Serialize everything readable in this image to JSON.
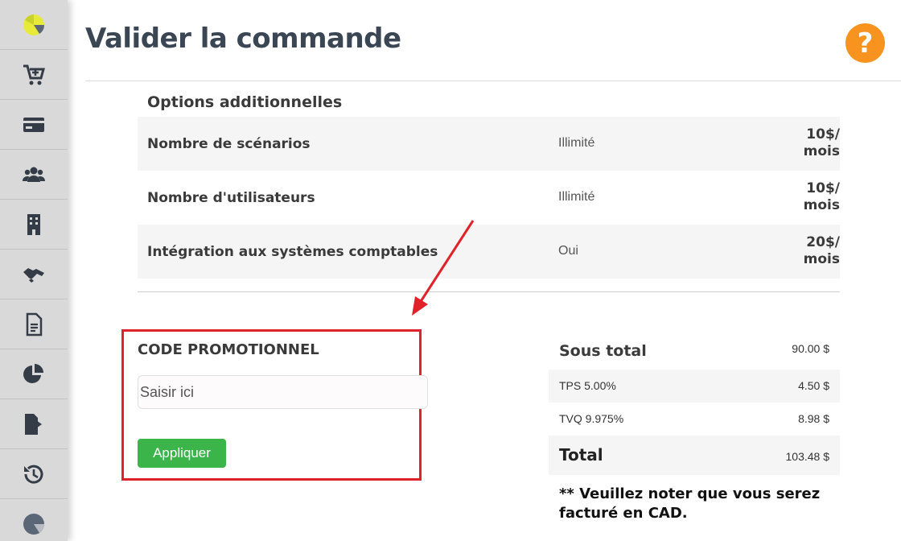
{
  "header": {
    "title": "Valider la commande",
    "help_label": "?"
  },
  "sidebar": {
    "items": [
      {
        "icon": "logo-icon"
      },
      {
        "icon": "cart-add-icon"
      },
      {
        "icon": "credit-card-icon"
      },
      {
        "icon": "users-icon"
      },
      {
        "icon": "building-icon"
      },
      {
        "icon": "handshake-icon"
      },
      {
        "icon": "document-icon"
      },
      {
        "icon": "pie-chart-icon"
      },
      {
        "icon": "file-export-icon"
      },
      {
        "icon": "history-icon"
      },
      {
        "icon": "logo-gray-icon"
      }
    ]
  },
  "options": {
    "title": "Options additionnelles",
    "rows": [
      {
        "name": "Nombre de scénarios",
        "value": "Illimité",
        "price_top": "10$/",
        "price_bottom": "mois"
      },
      {
        "name": "Nombre d'utilisateurs",
        "value": "Illimité",
        "price_top": "10$/",
        "price_bottom": "mois"
      },
      {
        "name": "Intégration aux systèmes comptables",
        "value": "Oui",
        "price_top": "20$/",
        "price_bottom": "mois"
      }
    ]
  },
  "promo": {
    "title": "CODE PROMOTIONNEL",
    "placeholder": "Saisir ici",
    "button": "Appliquer"
  },
  "totals": {
    "subtotal_label": "Sous total",
    "subtotal_value": "90.00 $",
    "tps_label": "TPS 5.00%",
    "tps_value": "4.50 $",
    "tvq_label": "TVQ 9.975%",
    "tvq_value": "8.98 $",
    "total_label": "Total",
    "total_value": "103.48 $"
  },
  "note": "** Veuillez noter que vous serez facturé en CAD.",
  "colors": {
    "sidebar": "#d9d9d9",
    "accent_orange": "#f7931e",
    "apply_green": "#3bb44a",
    "annotation_red": "#e0222a"
  }
}
